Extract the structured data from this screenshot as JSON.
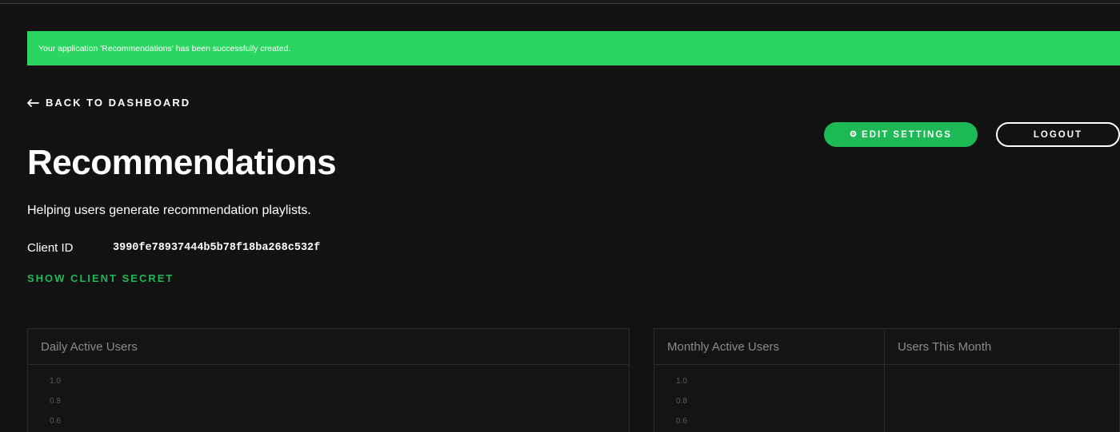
{
  "alert": {
    "message": "Your application 'Recommendations' has been successfully created."
  },
  "nav": {
    "back_label": "BACK TO DASHBOARD"
  },
  "app": {
    "name": "Recommendations",
    "description": "Helping users generate recommendation playlists.",
    "client_id_label": "Client ID",
    "client_id_value": "3990fe78937444b5b78f18ba268c532f",
    "show_secret_label": "SHOW CLIENT SECRET"
  },
  "actions": {
    "edit_settings_label": "EDIT SETTINGS",
    "logout_label": "LOGOUT"
  },
  "panels": {
    "daily": {
      "title": "Daily Active Users",
      "ticks": [
        "1.0",
        "0.8",
        "0.6"
      ]
    },
    "monthly": {
      "title": "Monthly Active Users",
      "ticks": [
        "1.0",
        "0.8",
        "0.6"
      ]
    },
    "users_this_month": {
      "title": "Users This Month"
    }
  },
  "colors": {
    "background": "#121212",
    "accent_green": "#1db954",
    "alert_green": "#2bd660",
    "muted_text": "#8a8a8a"
  },
  "icons": {
    "back": "arrow-left-icon",
    "settings": "gear-icon"
  }
}
